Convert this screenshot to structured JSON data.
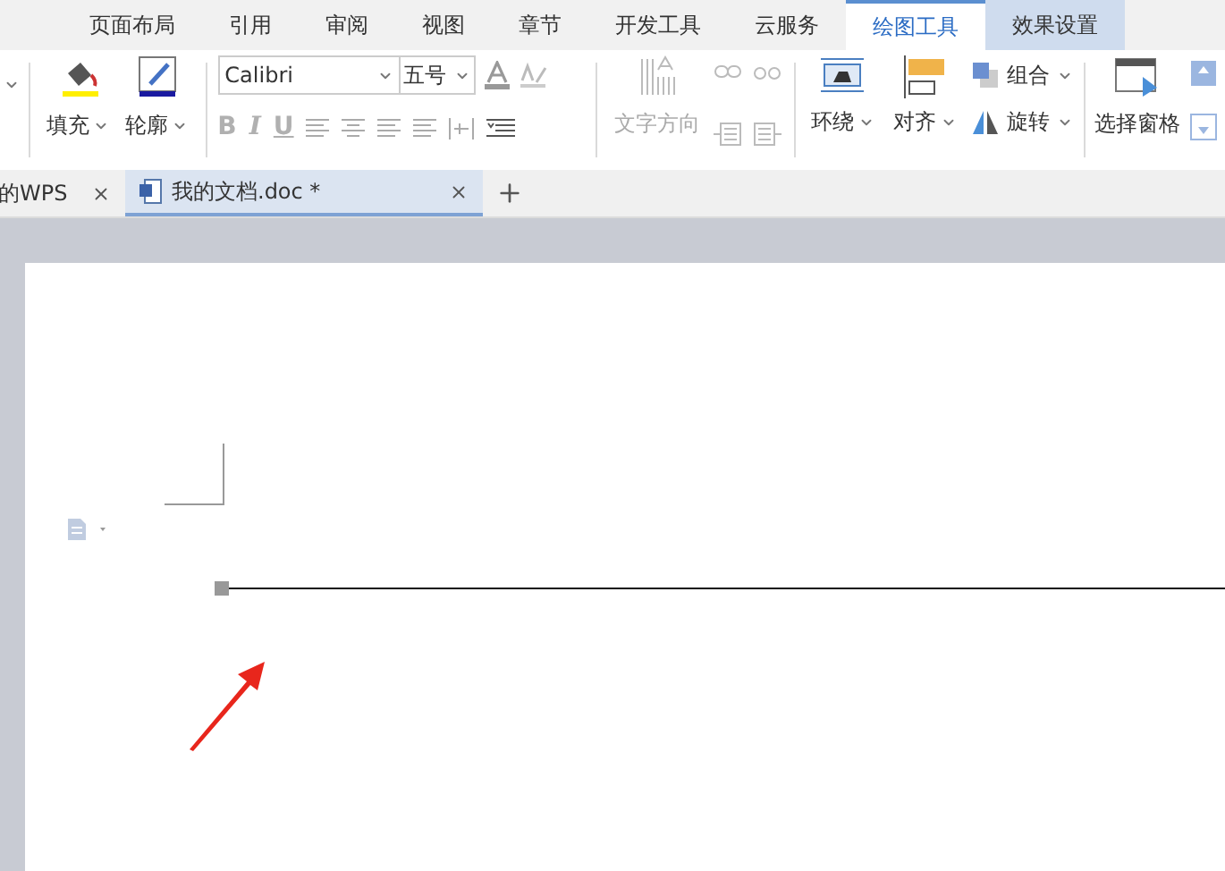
{
  "menu_tabs": [
    {
      "label": "页面布局",
      "selected": false,
      "contextual": false
    },
    {
      "label": "引用",
      "selected": false,
      "contextual": false
    },
    {
      "label": "审阅",
      "selected": false,
      "contextual": false
    },
    {
      "label": "视图",
      "selected": false,
      "contextual": false
    },
    {
      "label": "章节",
      "selected": false,
      "contextual": false
    },
    {
      "label": "开发工具",
      "selected": false,
      "contextual": false
    },
    {
      "label": "云服务",
      "selected": false,
      "contextual": false
    },
    {
      "label": "绘图工具",
      "selected": true,
      "contextual": true
    },
    {
      "label": "效果设置",
      "selected": false,
      "contextual": true
    }
  ],
  "ribbon": {
    "fill": "填充",
    "outline": "轮廓",
    "font": {
      "value": "Calibri"
    },
    "font_size": {
      "value": "五号"
    },
    "format_buttons": [
      {
        "label": "B",
        "disabled": true
      },
      {
        "label": "I",
        "disabled": true
      },
      {
        "label": "U",
        "disabled": true
      }
    ],
    "text_direction": {
      "label": "文字方向",
      "disabled": true
    },
    "wrap": "环绕",
    "align": "对齐",
    "group": "组合",
    "rotate": "旋转",
    "selection_pane": "选择窗格"
  },
  "document_tabs": [
    {
      "label": "的WPS",
      "selected": false,
      "kind": "home"
    },
    {
      "label": "我的文档.doc *",
      "selected": true,
      "kind": "doc"
    }
  ]
}
